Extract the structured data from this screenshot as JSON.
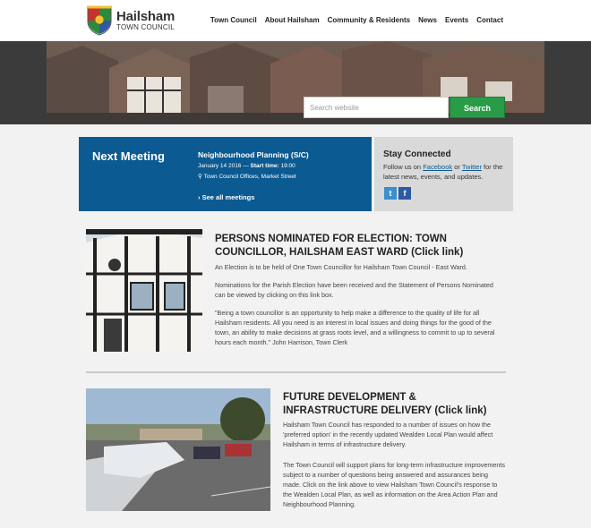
{
  "header": {
    "logo_name": "Hailsham",
    "logo_sub": "TOWN COUNCIL",
    "nav": [
      "Town Council",
      "About Hailsham",
      "Community & Residents",
      "News",
      "Events",
      "Contact"
    ]
  },
  "hero": {
    "search_placeholder": "Search website",
    "search_button": "Search"
  },
  "meeting": {
    "title": "Next Meeting",
    "name": "Neighbourhood Planning (S/C)",
    "date": "January 14 2016 —",
    "start_label": "Start time:",
    "start_time": "19:00",
    "location": "Town Council Offices, Market Street",
    "see_all": "See all meetings"
  },
  "stay": {
    "title": "Stay Connected",
    "text_before": "Follow us on",
    "facebook": "Facebook",
    "or": "or",
    "twitter": "Twitter",
    "text_after": "for the latest news, events, and updates."
  },
  "articles": [
    {
      "title": "PERSONS NOMINATED FOR ELECTION: TOWN COUNCILLOR, HAILSHAM EAST WARD (Click link)",
      "p1": "An Election is to be held of One Town Councillor for Hailsham Town Council - East Ward.",
      "p2": "Nominations for the Parish Election have been received and the Statement of Persons Nominated can be viewed by clicking on this link box.",
      "p3": "\"Being a town councillor is an opportunity to help make a difference to the quality of life for all Hailsham residents. All you need is an interest in local issues and doing things for the good of the town, an ability to make decisions at grass roots level, and a willingness to commit to up to several hours each month.\" John Harrison, Town Clerk"
    },
    {
      "title": "FUTURE DEVELOPMENT & INFRASTRUCTURE DELIVERY (Click link)",
      "p1": "Hailsham Town Council has responded to a number of issues on how the 'preferred option' in the recently updated Wealden Local Plan would affect Hailsham in terms of infrastructure delivery.",
      "p2": "The Town Council will support plans for long-term infrastructure improvements subject to a number of questions being answered and assurances being made. Click on the link above to view Hailsham Town Council's response to the Wealden Local Plan, as well as information on the Area Action Plan and Neighbourhood Planning."
    }
  ],
  "colors": {
    "brand_blue": "#0b5a91",
    "search_green": "#2a9c48",
    "twitter": "#3b8fd0",
    "facebook": "#2d5aa0"
  },
  "icons": [
    "crest-logo-icon",
    "map-marker-icon",
    "chevron-right-icon",
    "twitter-icon",
    "facebook-icon"
  ]
}
